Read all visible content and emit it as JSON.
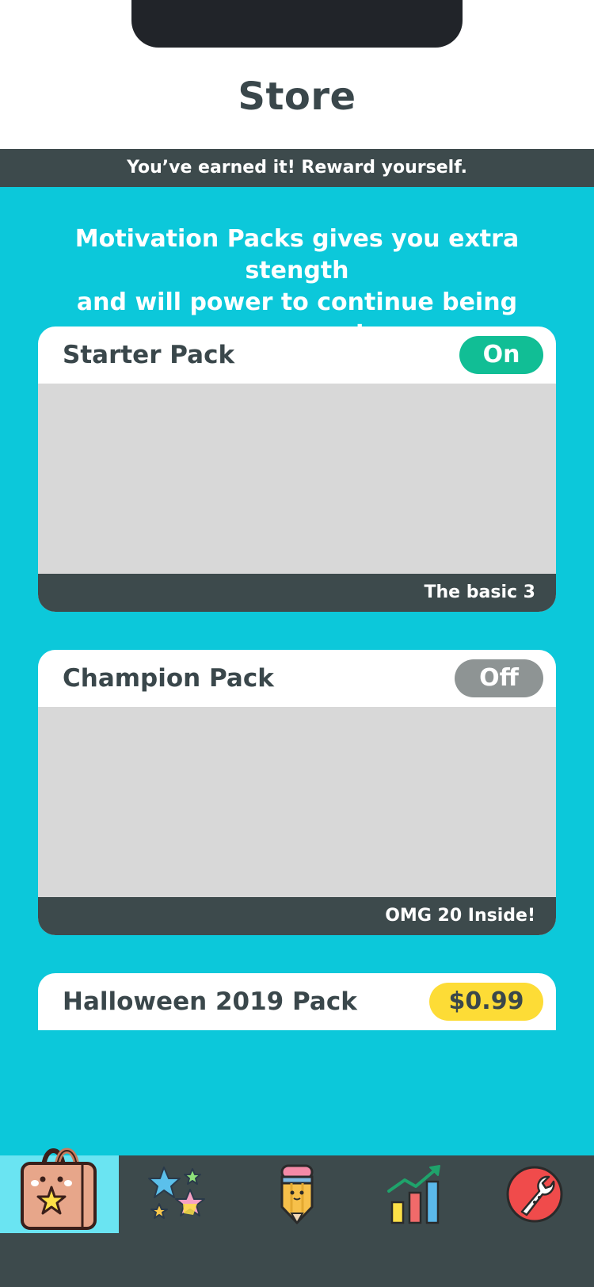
{
  "header": {
    "title": "Store"
  },
  "banner": {
    "text": "You’ve earned it! Reward yourself."
  },
  "intro": {
    "line1": "Motivation Packs gives you extra stength",
    "line2": "and will power to continue being awesome!"
  },
  "packs": [
    {
      "title": "Starter Pack",
      "badge": "On",
      "caption": "The basic 3"
    },
    {
      "title": "Champion Pack",
      "badge": "Off",
      "caption": "OMG 20 Inside!"
    },
    {
      "title": "Halloween 2019 Pack",
      "badge": "$0.99"
    }
  ],
  "tabbar": {
    "active_tab": "store",
    "tabs": [
      {
        "id": "store",
        "icon": "shopping-bag-icon"
      },
      {
        "id": "rewards",
        "icon": "stars-icon"
      },
      {
        "id": "edit",
        "icon": "pencil-icon"
      },
      {
        "id": "stats",
        "icon": "bar-chart-icon"
      },
      {
        "id": "settings",
        "icon": "wrench-icon"
      }
    ]
  },
  "colors": {
    "background": "#0cc8da",
    "dark": "#3d4a4c",
    "on": "#11be95",
    "off": "#8e9494",
    "price": "#fddc36",
    "active_tab": "#6ae4f2"
  }
}
